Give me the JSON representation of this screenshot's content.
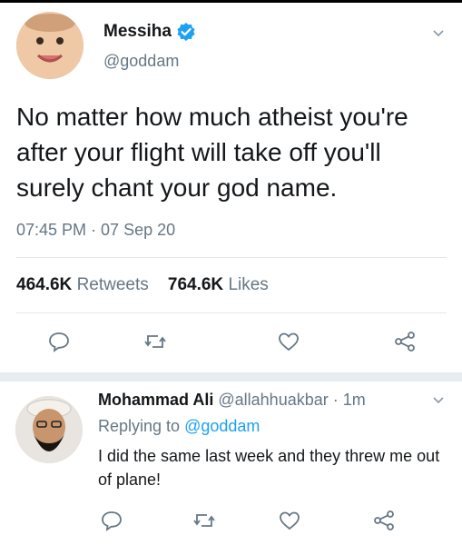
{
  "tweet": {
    "author_name": "Messiha",
    "handle": "@goddam",
    "text": "No matter how much atheist you're after your flight will take off you'll surely chant your god name.",
    "time": "07:45 PM · 07 Sep 20",
    "retweets_count": "464.6K",
    "retweets_label": "Retweets",
    "likes_count": "764.6K",
    "likes_label": "Likes"
  },
  "reply": {
    "author_name": "Mohammad Ali",
    "handle": "@allahhuakbar",
    "age": "· 1m",
    "replying_prefix": "Replying to",
    "replying_handle": "@goddam",
    "text": "I did the same last week and they threw me out of plane!"
  },
  "colors": {
    "secondary_text": "#657786",
    "link": "#1da1f2",
    "verified": "#1da1f2",
    "icon": "#657786"
  },
  "icons": [
    "verified-badge-icon",
    "chevron-down-icon",
    "reply-icon",
    "retweet-icon",
    "like-icon",
    "share-icon"
  ]
}
